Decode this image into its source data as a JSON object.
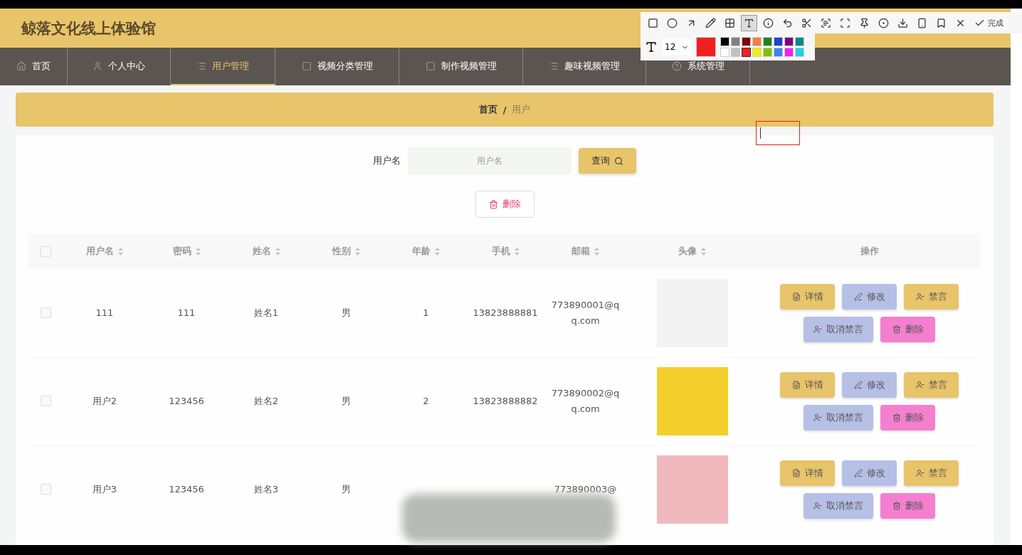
{
  "site_title": "鲸落文化线上体验馆",
  "nav": [
    {
      "label": "首页",
      "selected": false
    },
    {
      "label": "个人中心",
      "selected": false
    },
    {
      "label": "用户管理",
      "selected": true
    },
    {
      "label": "视频分类管理",
      "selected": false
    },
    {
      "label": "制作视频管理",
      "selected": false
    },
    {
      "label": "趣味视频管理",
      "selected": false
    },
    {
      "label": "系统管理",
      "selected": false
    }
  ],
  "breadcrumb": {
    "items": [
      "首页",
      "用户"
    ],
    "separator": "/"
  },
  "search": {
    "label": "用户名",
    "placeholder": "用户名",
    "button": "查询"
  },
  "delete_button": "删除",
  "table": {
    "select_all": {
      "checked": false
    },
    "columns": [
      "用户名",
      "密码",
      "姓名",
      "性别",
      "年龄",
      "手机",
      "邮箱",
      "头像",
      "操作"
    ],
    "rows": [
      {
        "checked": false,
        "cells": [
          "111",
          "111",
          "姓名1",
          "男",
          "1",
          "13823888881",
          "773890001@qq.com"
        ],
        "actions": [
          {
            "label": "详情",
            "kind": "detail"
          },
          {
            "label": "修改",
            "kind": "edit"
          },
          {
            "label": "禁言",
            "kind": "mute"
          },
          {
            "label": "取消禁言",
            "kind": "unmute"
          },
          {
            "label": "删除",
            "kind": "delete"
          }
        ]
      },
      {
        "checked": false,
        "cells": [
          "用户2",
          "123456",
          "姓名2",
          "男",
          "2",
          "13823888882",
          "773890002@qq.com"
        ],
        "actions": [
          {
            "label": "详情",
            "kind": "detail"
          },
          {
            "label": "修改",
            "kind": "edit"
          },
          {
            "label": "禁言",
            "kind": "mute"
          },
          {
            "label": "取消禁言",
            "kind": "unmute"
          },
          {
            "label": "删除",
            "kind": "delete"
          }
        ]
      },
      {
        "checked": false,
        "cells": [
          "用户3",
          "123456",
          "姓名3",
          "男",
          "",
          "",
          "773890003@"
        ],
        "blurred": true,
        "actions": [
          {
            "label": "详情",
            "kind": "detail"
          },
          {
            "label": "修改",
            "kind": "edit"
          },
          {
            "label": "禁言",
            "kind": "mute"
          },
          {
            "label": "取消禁言",
            "kind": "unmute"
          },
          {
            "label": "删除",
            "kind": "delete"
          }
        ]
      }
    ]
  },
  "capture_toolbar": {
    "tools": [
      {
        "kind": "rectangle",
        "selected": false
      },
      {
        "kind": "ellipse",
        "selected": false
      },
      {
        "kind": "arrow",
        "selected": false
      },
      {
        "kind": "pen",
        "selected": false
      },
      {
        "kind": "mosaic",
        "selected": false
      },
      {
        "kind": "text",
        "selected": true
      },
      {
        "kind": "number",
        "selected": false
      },
      {
        "kind": "undo",
        "selected": false
      },
      {
        "kind": "cut",
        "selected": false
      },
      {
        "kind": "ocr",
        "selected": false
      },
      {
        "kind": "scan",
        "selected": false
      },
      {
        "kind": "pin",
        "selected": false
      },
      {
        "kind": "record",
        "selected": false
      },
      {
        "kind": "download",
        "selected": false
      },
      {
        "kind": "phone",
        "selected": false
      },
      {
        "kind": "bookmark",
        "selected": false
      },
      {
        "kind": "close",
        "selected": false
      }
    ],
    "done": "完成",
    "font_size": "12",
    "palette": [
      {
        "color": "#000000",
        "selected": false
      },
      {
        "color": "#808080",
        "selected": false
      },
      {
        "color": "#800000",
        "selected": false
      },
      {
        "color": "#f08040",
        "selected": false
      },
      {
        "color": "#208020",
        "selected": false
      },
      {
        "color": "#2040d0",
        "selected": false
      },
      {
        "color": "#800080",
        "selected": false
      },
      {
        "color": "#008b8b",
        "selected": false
      },
      {
        "color": "#ffffff",
        "selected": false
      },
      {
        "color": "#c0c0c0",
        "selected": false
      },
      {
        "color": "#f02020",
        "selected": true
      },
      {
        "color": "#f0f000",
        "selected": false
      },
      {
        "color": "#80c000",
        "selected": false
      },
      {
        "color": "#4080f0",
        "selected": false
      },
      {
        "color": "#f020f0",
        "selected": false
      },
      {
        "color": "#20d0e0",
        "selected": false
      }
    ]
  }
}
